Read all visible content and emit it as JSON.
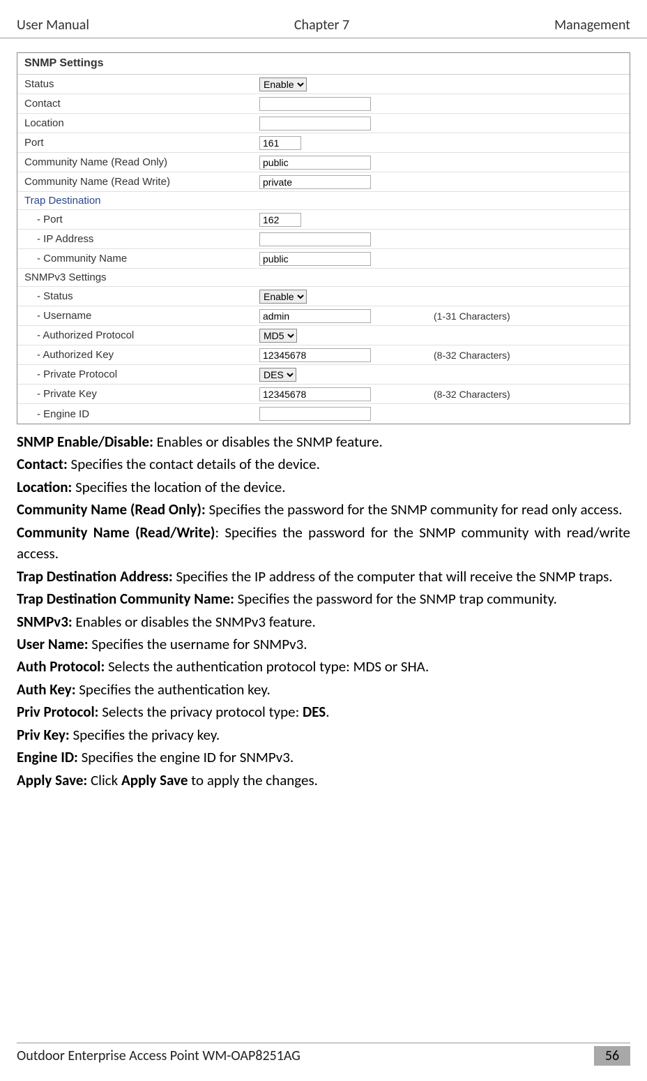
{
  "header": {
    "left": "User Manual",
    "center": "Chapter 7",
    "right": "Management"
  },
  "snmp": {
    "title": "SNMP Settings",
    "status_label": "Status",
    "status_value": "Enable",
    "contact_label": "Contact",
    "contact_value": "",
    "location_label": "Location",
    "location_value": "",
    "port_label": "Port",
    "port_value": "161",
    "comm_ro_label": "Community Name (Read Only)",
    "comm_ro_value": "public",
    "comm_rw_label": "Community Name (Read Write)",
    "comm_rw_value": "private",
    "trap_header": "Trap Destination",
    "trap_port_label": "- Port",
    "trap_port_value": "162",
    "trap_ip_label": "- IP Address",
    "trap_ip_value": "",
    "trap_comm_label": "- Community Name",
    "trap_comm_value": "public",
    "v3_header": "SNMPv3 Settings",
    "v3_status_label": "- Status",
    "v3_status_value": "Enable",
    "v3_user_label": "- Username",
    "v3_user_value": "admin",
    "v3_user_note": "(1-31 Characters)",
    "v3_authproto_label": "- Authorized Protocol",
    "v3_authproto_value": "MD5",
    "v3_authkey_label": "- Authorized Key",
    "v3_authkey_value": "12345678",
    "v3_authkey_note": "(8-32 Characters)",
    "v3_privproto_label": "- Private Protocol",
    "v3_privproto_value": "DES",
    "v3_privkey_label": "- Private Key",
    "v3_privkey_value": "12345678",
    "v3_privkey_note": "(8-32 Characters)",
    "v3_engine_label": "- Engine ID",
    "v3_engine_value": ""
  },
  "desc": {
    "p1a": "SNMP Enable/Disable:",
    "p1b": " Enables or disables the SNMP feature.",
    "p2a": "Contact:",
    "p2b": " Specifies the contact details of the device.",
    "p3a": "Location:",
    "p3b": " Specifies the location of the device.",
    "p4a": "Community Name (Read Only):",
    "p4b": " Specifies the password for the SNMP community for read only access.",
    "p5a": "Community Name (Read/Write)",
    "p5b": ": Specifies the password for the SNMP community with read/write access.",
    "p6a": "Trap Destination Address:",
    "p6b": " Specifies the IP address of the computer that will receive the SNMP traps.",
    "p7a": "Trap Destination Community Name:",
    "p7b": " Specifies the password for the SNMP trap community.",
    "p8a": "SNMPv3:",
    "p8b": " Enables or disables the SNMPv3 feature.",
    "p9a": "User Name:",
    "p9b": " Specifies the username for SNMPv3.",
    "p10a": "Auth Protocol:",
    "p10b": " Selects the authentication protocol type: MDS or SHA.",
    "p11a": "Auth Key:",
    "p11b": " Specifies the authentication key.",
    "p12a": "Priv Protocol:",
    "p12b": " Selects the privacy protocol type: ",
    "p12c": "DES",
    "p12d": ".",
    "p13a": "Priv Key:",
    "p13b": " Specifies the privacy key.",
    "p14a": "Engine ID:",
    "p14b": " Specifies the engine ID for SNMPv3.",
    "p15a": "Apply Save:",
    "p15b": " Click ",
    "p15c": "Apply Save",
    "p15d": " to apply the changes."
  },
  "footer": {
    "text": "Outdoor Enterprise Access Point WM-OAP8251AG",
    "page": "56"
  }
}
